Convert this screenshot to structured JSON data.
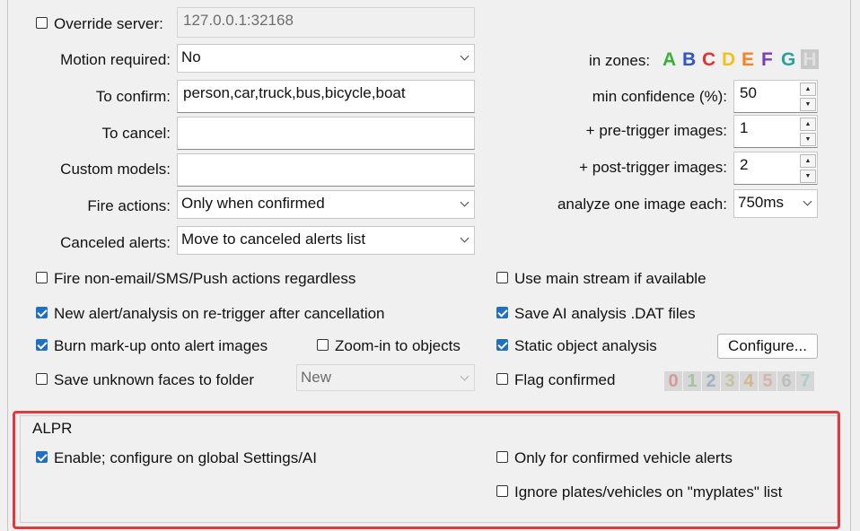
{
  "server": {
    "override_label": "Override server:",
    "override_checked": false,
    "address": "127.0.0.1:32168"
  },
  "form": {
    "motion_label": "Motion required:",
    "motion_value": "No",
    "confirm_label": "To confirm:",
    "confirm_value": "person,car,truck,bus,bicycle,boat",
    "cancel_label": "To cancel:",
    "cancel_value": "",
    "custom_label": "Custom models:",
    "custom_value": "",
    "fire_label": "Fire actions:",
    "fire_value": "Only when confirmed",
    "canceled_label": "Canceled alerts:",
    "canceled_value": "Move to canceled alerts list"
  },
  "right": {
    "zones_label": "in zones:",
    "zones": [
      {
        "letter": "A",
        "color": "#3cae3a"
      },
      {
        "letter": "B",
        "color": "#2e55c9"
      },
      {
        "letter": "C",
        "color": "#e23333"
      },
      {
        "letter": "D",
        "color": "#f2c21b"
      },
      {
        "letter": "E",
        "color": "#ff7f1e"
      },
      {
        "letter": "F",
        "color": "#7a3dbb"
      },
      {
        "letter": "G",
        "color": "#2aa39c"
      },
      {
        "letter": "H",
        "color": "#c8c8c8"
      }
    ],
    "min_conf_label": "min confidence (%):",
    "min_conf_value": "50",
    "pre_label": "+ pre-trigger images:",
    "pre_value": "1",
    "post_label": "+ post-trigger images:",
    "post_value": "2",
    "analyze_label": "analyze one image each:",
    "analyze_value": "750ms"
  },
  "checks": {
    "fire_non_email": {
      "label": "Fire non-email/SMS/Push actions regardless",
      "checked": false
    },
    "new_alert": {
      "label": "New alert/analysis on re-trigger after cancellation",
      "checked": true
    },
    "burn_markup": {
      "label": "Burn mark-up onto alert images",
      "checked": true
    },
    "zoom_in": {
      "label": "Zoom-in to objects",
      "checked": false
    },
    "save_faces": {
      "label": "Save unknown faces to folder",
      "checked": false
    },
    "faces_folder_value": "New",
    "main_stream": {
      "label": "Use main stream if available",
      "checked": false
    },
    "save_dat": {
      "label": "Save AI analysis .DAT files",
      "checked": true
    },
    "static_obj": {
      "label": "Static object analysis",
      "checked": true
    },
    "configure_label": "Configure...",
    "flag_confirmed": {
      "label": "Flag confirmed",
      "checked": false
    },
    "flag_digits": [
      "0",
      "1",
      "2",
      "3",
      "4",
      "5",
      "6",
      "7"
    ],
    "flag_colors": [
      "#d79898",
      "#a4c39c",
      "#9fb1c6",
      "#c4c49d",
      "#d2b88c",
      "#d8b4a8",
      "#bdbdbd",
      "#a9d0cb"
    ]
  },
  "alpr": {
    "title": "ALPR",
    "enable": {
      "label": "Enable; configure on global Settings/AI",
      "checked": true
    },
    "only_vehicle": {
      "label": "Only for confirmed vehicle alerts",
      "checked": false
    },
    "ignore_plates": {
      "label": "Ignore plates/vehicles on \"myplates\" list",
      "checked": false
    }
  }
}
